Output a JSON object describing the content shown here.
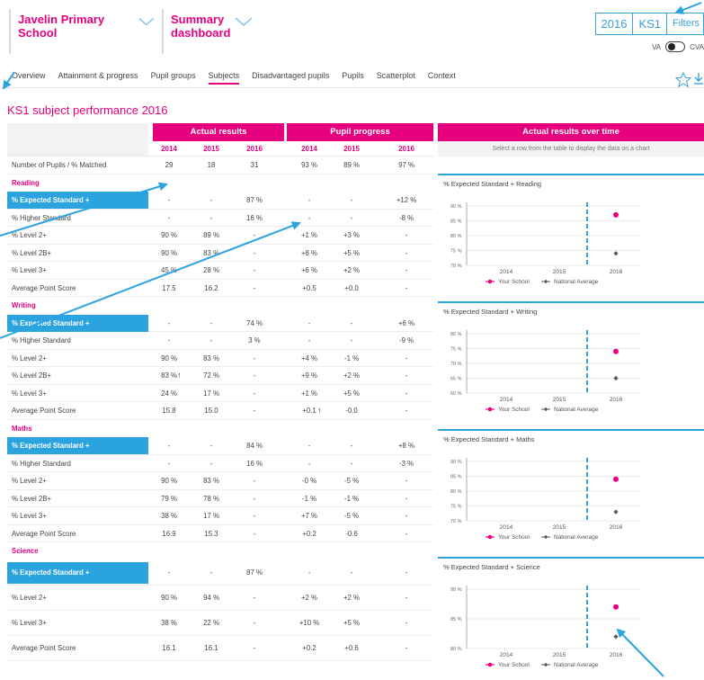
{
  "header": {
    "school": "Javelin Primary School",
    "dashboard": "Summary dashboard",
    "year": "2016",
    "keystage": "KS1",
    "filters": "Filters",
    "va": "VA",
    "cva": "CVA"
  },
  "nav": {
    "tabs": [
      "Overview",
      "Attainment & progress",
      "Pupil groups",
      "Subjects",
      "Disadvantaged pupils",
      "Pupils",
      "Scatterplot",
      "Context"
    ],
    "active": "Subjects"
  },
  "page_title": "KS1 subject performance 2016",
  "table": {
    "actual_header": "Actual results",
    "progress_header": "Pupil progress",
    "years": [
      "2014",
      "2015",
      "2016"
    ],
    "number_row": {
      "label": "Number of Pupils / % Matched",
      "values": [
        "29",
        "18",
        "31",
        "93 %",
        "89 %",
        "97 %"
      ]
    },
    "sections": [
      {
        "name": "Reading",
        "rows": [
          {
            "label": "% Expected Standard +",
            "values": [
              "-",
              "-",
              "87 %",
              "-",
              "-",
              "+12 %"
            ],
            "highlight": true
          },
          {
            "label": "% Higher Standard",
            "values": [
              "-",
              "-",
              "16 %",
              "-",
              "-",
              "-8 %"
            ]
          },
          {
            "label": "% Level 2+",
            "values": [
              "90 %",
              "89 %",
              "-",
              "+1 %",
              "+3 %",
              "-"
            ]
          },
          {
            "label": "% Level 2B+",
            "values": [
              "90 %",
              "83 %",
              "-",
              "+8 %",
              "+5 %",
              "-"
            ]
          },
          {
            "label": "% Level 3+",
            "values": [
              "45 %",
              "28 %",
              "-",
              "+6 %",
              "+2 %",
              "-"
            ]
          },
          {
            "label": "Average Point Score",
            "values": [
              "17.5",
              "16.2",
              "-",
              "+0.5",
              "+0.0",
              "-"
            ]
          }
        ]
      },
      {
        "name": "Writing",
        "rows": [
          {
            "label": "% Expected Standard +",
            "values": [
              "-",
              "-",
              "74 %",
              "-",
              "-",
              "+6 %"
            ],
            "highlight": true
          },
          {
            "label": "% Higher Standard",
            "values": [
              "-",
              "-",
              "3 %",
              "-",
              "-",
              "-9 %"
            ]
          },
          {
            "label": "% Level 2+",
            "values": [
              "90 %",
              "83 %",
              "-",
              "+4 %",
              "-1 %",
              "-"
            ]
          },
          {
            "label": "% Level 2B+",
            "values": [
              "83 %",
              "72 %",
              "-",
              "+9 %",
              "+2 %",
              "-"
            ],
            "up_actual": true
          },
          {
            "label": "% Level 3+",
            "values": [
              "24 %",
              "17 %",
              "-",
              "+1 %",
              "+5 %",
              "-"
            ]
          },
          {
            "label": "Average Point Score",
            "values": [
              "15.8",
              "15.0",
              "-",
              "+0.1",
              "-0.0",
              "-"
            ],
            "up_progress": true
          }
        ]
      },
      {
        "name": "Maths",
        "rows": [
          {
            "label": "% Expected Standard +",
            "values": [
              "-",
              "-",
              "84 %",
              "-",
              "-",
              "+8 %"
            ],
            "highlight": true
          },
          {
            "label": "% Higher Standard",
            "values": [
              "-",
              "-",
              "16 %",
              "-",
              "-",
              "-3 %"
            ]
          },
          {
            "label": "% Level 2+",
            "values": [
              "90 %",
              "83 %",
              "-",
              "-0 %",
              "-5 %",
              "-"
            ]
          },
          {
            "label": "% Level 2B+",
            "values": [
              "79 %",
              "78 %",
              "-",
              "-1 %",
              "-1 %",
              "-"
            ]
          },
          {
            "label": "% Level 3+",
            "values": [
              "38 %",
              "17 %",
              "-",
              "+7 %",
              "-5 %",
              "-"
            ]
          },
          {
            "label": "Average Point Score",
            "values": [
              "16.9",
              "15.3",
              "-",
              "+0.2",
              "-0.6",
              "-"
            ]
          }
        ]
      },
      {
        "name": "Science",
        "rows": [
          {
            "label": "% Expected Standard +",
            "values": [
              "-",
              "-",
              "87 %",
              "-",
              "-",
              "-"
            ],
            "highlight": true
          },
          {
            "label": "% Level 2+",
            "values": [
              "90 %",
              "94 %",
              "-",
              "+2 %",
              "+2 %",
              "-"
            ]
          },
          {
            "label": "% Level 3+",
            "values": [
              "38 %",
              "22 %",
              "-",
              "+10 %",
              "+5 %",
              "-"
            ]
          },
          {
            "label": "Average Point Score",
            "values": [
              "16.1",
              "16.1",
              "-",
              "+0.2",
              "+0.6",
              "-"
            ]
          }
        ]
      }
    ]
  },
  "over_time": {
    "header": "Actual results over time",
    "subheader": "Select a row from the table to display the data on a chart"
  },
  "legend": {
    "school": "Your School",
    "national": "National Average"
  },
  "colors": {
    "pink": "#e6007e",
    "blue": "#2aa3df",
    "grey": "#555555"
  },
  "chart_data": [
    {
      "type": "scatter",
      "title": "% Expected Standard + Reading",
      "categories": [
        "2014",
        "2015",
        "2016"
      ],
      "ylim": [
        70,
        90
      ],
      "yticks": [
        "90 %",
        "85 %",
        "80 %",
        "75 %",
        "70 %"
      ],
      "series": [
        {
          "name": "Your School",
          "values": [
            null,
            null,
            87
          ]
        },
        {
          "name": "National Average",
          "values": [
            null,
            null,
            74
          ]
        }
      ]
    },
    {
      "type": "scatter",
      "title": "% Expected Standard + Writing",
      "categories": [
        "2014",
        "2015",
        "2016"
      ],
      "ylim": [
        60,
        80
      ],
      "yticks": [
        "80 %",
        "75 %",
        "70 %",
        "65 %",
        "60 %"
      ],
      "series": [
        {
          "name": "Your School",
          "values": [
            null,
            null,
            74
          ]
        },
        {
          "name": "National Average",
          "values": [
            null,
            null,
            65
          ]
        }
      ]
    },
    {
      "type": "scatter",
      "title": "% Expected Standard + Maths",
      "categories": [
        "2014",
        "2015",
        "2016"
      ],
      "ylim": [
        70,
        90
      ],
      "yticks": [
        "90 %",
        "85 %",
        "80 %",
        "75 %",
        "70 %"
      ],
      "series": [
        {
          "name": "Your School",
          "values": [
            null,
            null,
            84
          ]
        },
        {
          "name": "National Average",
          "values": [
            null,
            null,
            73
          ]
        }
      ]
    },
    {
      "type": "scatter",
      "title": "% Expected Standard + Science",
      "categories": [
        "2014",
        "2015",
        "2016"
      ],
      "ylim": [
        80,
        90
      ],
      "yticks": [
        "90 %",
        "85 %",
        "80 %"
      ],
      "series": [
        {
          "name": "Your School",
          "values": [
            null,
            null,
            87
          ]
        },
        {
          "name": "National Average",
          "values": [
            null,
            null,
            82
          ]
        }
      ]
    }
  ]
}
